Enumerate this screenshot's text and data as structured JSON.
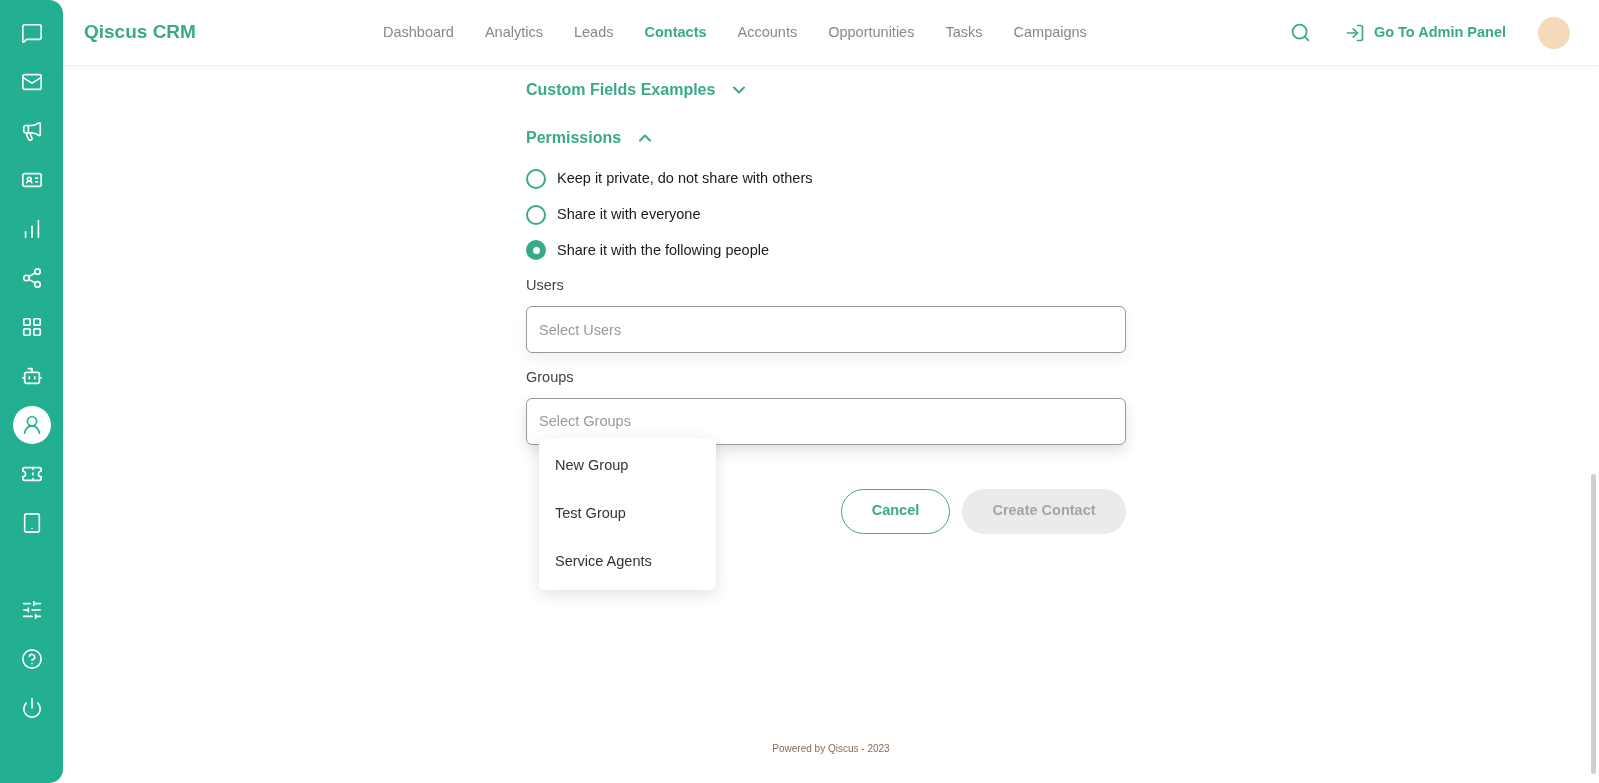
{
  "sidebar": {
    "top_items": [
      {
        "selected": false
      },
      {
        "selected": false
      },
      {
        "selected": false
      },
      {
        "selected": false
      },
      {
        "selected": false
      },
      {
        "selected": false
      },
      {
        "selected": false
      },
      {
        "selected": false
      },
      {
        "selected": true
      },
      {
        "selected": false
      },
      {
        "selected": false
      }
    ],
    "bottom_items": [
      {
        "selected": false
      },
      {
        "selected": false
      },
      {
        "selected": false
      }
    ]
  },
  "header": {
    "logo": "Qiscus CRM",
    "nav": [
      {
        "label": "Dashboard",
        "selected": false
      },
      {
        "label": "Analytics",
        "selected": false
      },
      {
        "label": "Leads",
        "selected": false
      },
      {
        "label": "Contacts",
        "selected": true
      },
      {
        "label": "Accounts",
        "selected": false
      },
      {
        "label": "Opportunities",
        "selected": false
      },
      {
        "label": "Tasks",
        "selected": false
      },
      {
        "label": "Campaigns",
        "selected": false
      }
    ],
    "admin_link": "Go To Admin Panel"
  },
  "form": {
    "sections": [
      {
        "title": "Custom Fields Examples",
        "expanded": false
      },
      {
        "title": "Permissions",
        "expanded": true
      }
    ],
    "radios": [
      {
        "label": "Keep it private, do not share with others",
        "selected": false
      },
      {
        "label": "Share it with everyone",
        "selected": false
      },
      {
        "label": "Share it with the following people",
        "selected": true
      }
    ],
    "fields": [
      {
        "label": "Users",
        "placeholder": "Select Users",
        "focused": false
      },
      {
        "label": "Groups",
        "placeholder": "Select Groups",
        "focused": true
      }
    ],
    "dropdown_options": [
      "New Group",
      "Test Group",
      "Service Agents"
    ],
    "buttons": [
      {
        "label": "Cancel",
        "kind": "outline"
      },
      {
        "label": "Create Contact",
        "kind": "disabled"
      }
    ]
  },
  "footer": "Powered by Qiscus - 2023"
}
